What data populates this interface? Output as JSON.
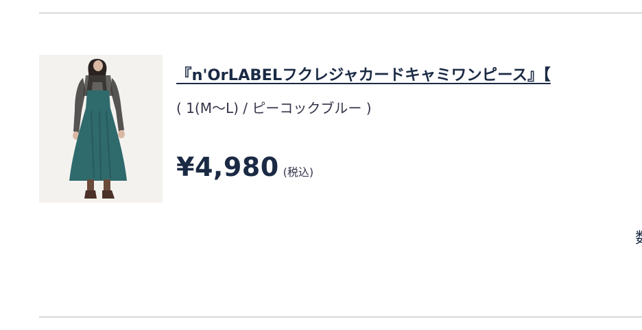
{
  "product": {
    "title": "『n'OrLABELフクレジャカードキャミワンピース』【",
    "variant": "( 1(M〜L) / ピーコックブルー )",
    "price": "¥4,980",
    "tax_note": "(税込)",
    "image_icon": "product-photo-dress",
    "quantity_label": "数"
  },
  "colors": {
    "text_navy": "#1b2a44",
    "dress_teal": "#2f6a6c",
    "divider": "#d8d8d8"
  }
}
